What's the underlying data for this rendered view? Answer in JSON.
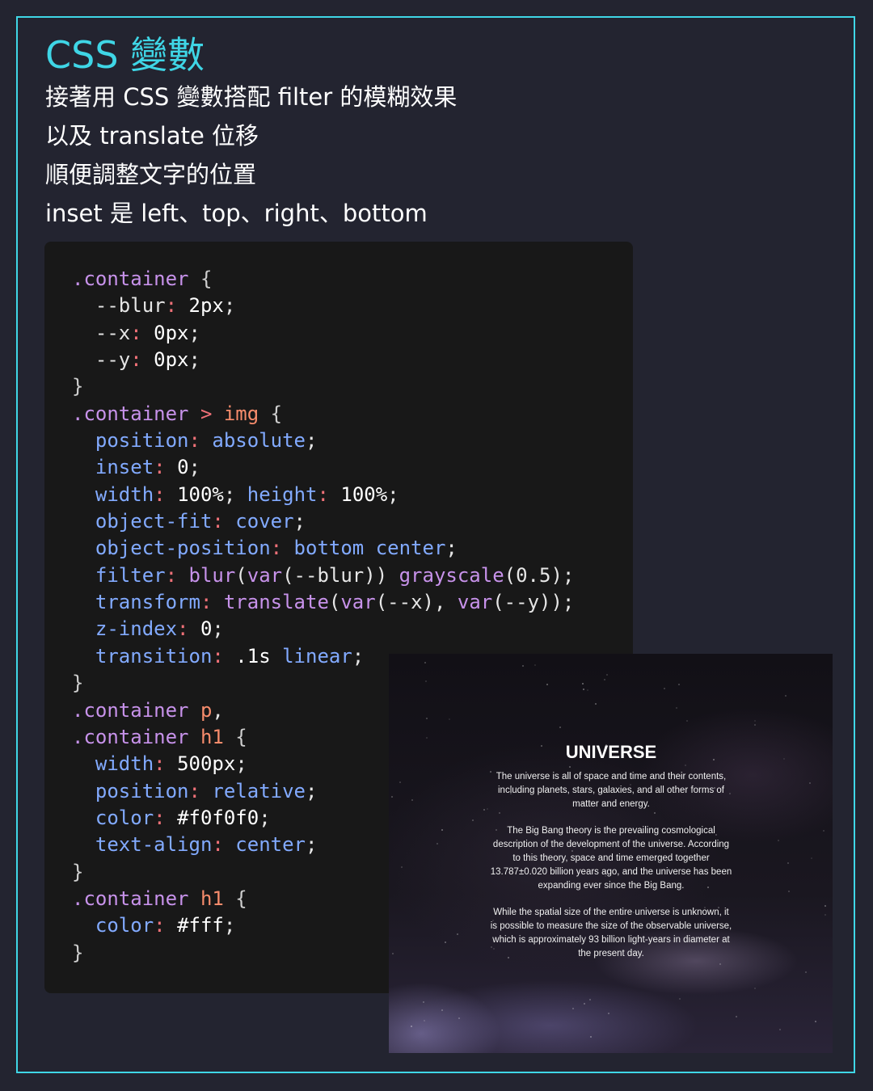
{
  "title": "CSS 變數",
  "description": [
    "接著用 CSS 變數搭配 filter 的模糊效果",
    "以及 translate 位移",
    "順便調整文字的位置",
    "inset 是 left、top、right、bottom"
  ],
  "code_lines": [
    [
      {
        "t": ".container",
        "c": "sel"
      },
      {
        "t": " {",
        "c": "br"
      }
    ],
    [
      {
        "t": "  --blur",
        "c": "var"
      },
      {
        "t": ": ",
        "c": "op"
      },
      {
        "t": "2px",
        "c": "num"
      },
      {
        "t": ";",
        "c": "pun"
      }
    ],
    [
      {
        "t": "  --x",
        "c": "var"
      },
      {
        "t": ": ",
        "c": "op"
      },
      {
        "t": "0px",
        "c": "num"
      },
      {
        "t": ";",
        "c": "pun"
      }
    ],
    [
      {
        "t": "  --y",
        "c": "var"
      },
      {
        "t": ": ",
        "c": "op"
      },
      {
        "t": "0px",
        "c": "num"
      },
      {
        "t": ";",
        "c": "pun"
      }
    ],
    [
      {
        "t": "}",
        "c": "br"
      }
    ],
    [
      {
        "t": ".container",
        "c": "sel"
      },
      {
        "t": " > ",
        "c": "op"
      },
      {
        "t": "img",
        "c": "tag"
      },
      {
        "t": " {",
        "c": "br"
      }
    ],
    [
      {
        "t": "  position",
        "c": "prop"
      },
      {
        "t": ": ",
        "c": "op"
      },
      {
        "t": "absolute",
        "c": "kw"
      },
      {
        "t": ";",
        "c": "pun"
      }
    ],
    [
      {
        "t": "  inset",
        "c": "prop"
      },
      {
        "t": ": ",
        "c": "op"
      },
      {
        "t": "0",
        "c": "num"
      },
      {
        "t": ";",
        "c": "pun"
      }
    ],
    [
      {
        "t": "  width",
        "c": "prop"
      },
      {
        "t": ": ",
        "c": "op"
      },
      {
        "t": "100%",
        "c": "num"
      },
      {
        "t": "; ",
        "c": "pun"
      },
      {
        "t": "height",
        "c": "prop"
      },
      {
        "t": ": ",
        "c": "op"
      },
      {
        "t": "100%",
        "c": "num"
      },
      {
        "t": ";",
        "c": "pun"
      }
    ],
    [
      {
        "t": "  object-fit",
        "c": "prop"
      },
      {
        "t": ": ",
        "c": "op"
      },
      {
        "t": "cover",
        "c": "kw"
      },
      {
        "t": ";",
        "c": "pun"
      }
    ],
    [
      {
        "t": "  object-position",
        "c": "prop"
      },
      {
        "t": ": ",
        "c": "op"
      },
      {
        "t": "bottom center",
        "c": "kw"
      },
      {
        "t": ";",
        "c": "pun"
      }
    ],
    [
      {
        "t": "  filter",
        "c": "prop"
      },
      {
        "t": ": ",
        "c": "op"
      },
      {
        "t": "blur",
        "c": "fn"
      },
      {
        "t": "(",
        "c": "pun"
      },
      {
        "t": "var",
        "c": "fn"
      },
      {
        "t": "(--blur)) ",
        "c": "pun"
      },
      {
        "t": "grayscale",
        "c": "fn"
      },
      {
        "t": "(0.5);",
        "c": "pun"
      }
    ],
    [
      {
        "t": "  transform",
        "c": "prop"
      },
      {
        "t": ": ",
        "c": "op"
      },
      {
        "t": "translate",
        "c": "fn"
      },
      {
        "t": "(",
        "c": "pun"
      },
      {
        "t": "var",
        "c": "fn"
      },
      {
        "t": "(--x), ",
        "c": "pun"
      },
      {
        "t": "var",
        "c": "fn"
      },
      {
        "t": "(--y));",
        "c": "pun"
      }
    ],
    [
      {
        "t": "  z-index",
        "c": "prop"
      },
      {
        "t": ": ",
        "c": "op"
      },
      {
        "t": "0",
        "c": "num"
      },
      {
        "t": ";",
        "c": "pun"
      }
    ],
    [
      {
        "t": "  transition",
        "c": "prop"
      },
      {
        "t": ": ",
        "c": "op"
      },
      {
        "t": ".1s ",
        "c": "num"
      },
      {
        "t": "linear",
        "c": "kw"
      },
      {
        "t": ";",
        "c": "pun"
      }
    ],
    [
      {
        "t": "}",
        "c": "br"
      }
    ],
    [
      {
        "t": ".container",
        "c": "sel"
      },
      {
        "t": " ",
        "c": "pun"
      },
      {
        "t": "p",
        "c": "tag"
      },
      {
        "t": ",",
        "c": "pun"
      }
    ],
    [
      {
        "t": ".container",
        "c": "sel"
      },
      {
        "t": " ",
        "c": "pun"
      },
      {
        "t": "h1",
        "c": "tag"
      },
      {
        "t": " {",
        "c": "br"
      }
    ],
    [
      {
        "t": "  width",
        "c": "prop"
      },
      {
        "t": ": ",
        "c": "op"
      },
      {
        "t": "500px",
        "c": "num"
      },
      {
        "t": ";",
        "c": "pun"
      }
    ],
    [
      {
        "t": "  position",
        "c": "prop"
      },
      {
        "t": ": ",
        "c": "op"
      },
      {
        "t": "relative",
        "c": "kw"
      },
      {
        "t": ";",
        "c": "pun"
      }
    ],
    [
      {
        "t": "  color",
        "c": "prop"
      },
      {
        "t": ": ",
        "c": "op"
      },
      {
        "t": "#f0f0f0",
        "c": "num"
      },
      {
        "t": ";",
        "c": "pun"
      }
    ],
    [
      {
        "t": "  text-align",
        "c": "prop"
      },
      {
        "t": ": ",
        "c": "op"
      },
      {
        "t": "center",
        "c": "kw"
      },
      {
        "t": ";",
        "c": "pun"
      }
    ],
    [
      {
        "t": "}",
        "c": "br"
      }
    ],
    [
      {
        "t": ".container",
        "c": "sel"
      },
      {
        "t": " ",
        "c": "pun"
      },
      {
        "t": "h1",
        "c": "tag"
      },
      {
        "t": " {",
        "c": "br"
      }
    ],
    [
      {
        "t": "  color",
        "c": "prop"
      },
      {
        "t": ": ",
        "c": "op"
      },
      {
        "t": "#fff",
        "c": "num"
      },
      {
        "t": ";",
        "c": "pun"
      }
    ],
    [
      {
        "t": "}",
        "c": "br"
      }
    ]
  ],
  "preview": {
    "heading": "UNIVERSE",
    "paragraphs": [
      "The universe is all of space and time and their contents, including planets, stars, galaxies, and all other forms of matter and energy.",
      "The Big Bang theory is the prevailing cosmological description of the development of the universe. According to this theory, space and time emerged together 13.787±0.020 billion years ago, and the universe has been expanding ever since the Big Bang.",
      "While the spatial size of the entire universe is unknown, it is possible to measure the size of the observable universe, which is approximately 93 billion light-years in diameter at the present day."
    ]
  },
  "colors": {
    "accent": "#3fd6e6",
    "background": "#232430",
    "code_background": "#181818"
  }
}
